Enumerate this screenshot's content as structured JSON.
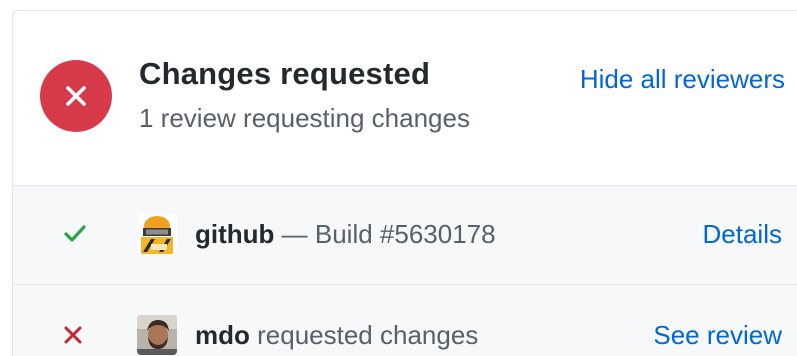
{
  "header": {
    "status_icon": "x-icon",
    "status_color": "#d73a49",
    "title": "Changes requested",
    "subtitle": "1 review requesting changes",
    "hide_link": "Hide all reviewers"
  },
  "reviews": [
    {
      "status_icon": "check-icon",
      "status_color": "#28a745",
      "avatar": "bot-avatar",
      "name": "github",
      "detail": " — Build #5630178",
      "link": "Details"
    },
    {
      "status_icon": "x-icon",
      "status_color": "#cb2431",
      "avatar": "user-avatar",
      "name": "mdo",
      "detail": " requested changes",
      "link": "See review"
    }
  ],
  "colors": {
    "link": "#0366d6",
    "row_background": "#f6f8fa",
    "border": "#e1e4e8"
  }
}
